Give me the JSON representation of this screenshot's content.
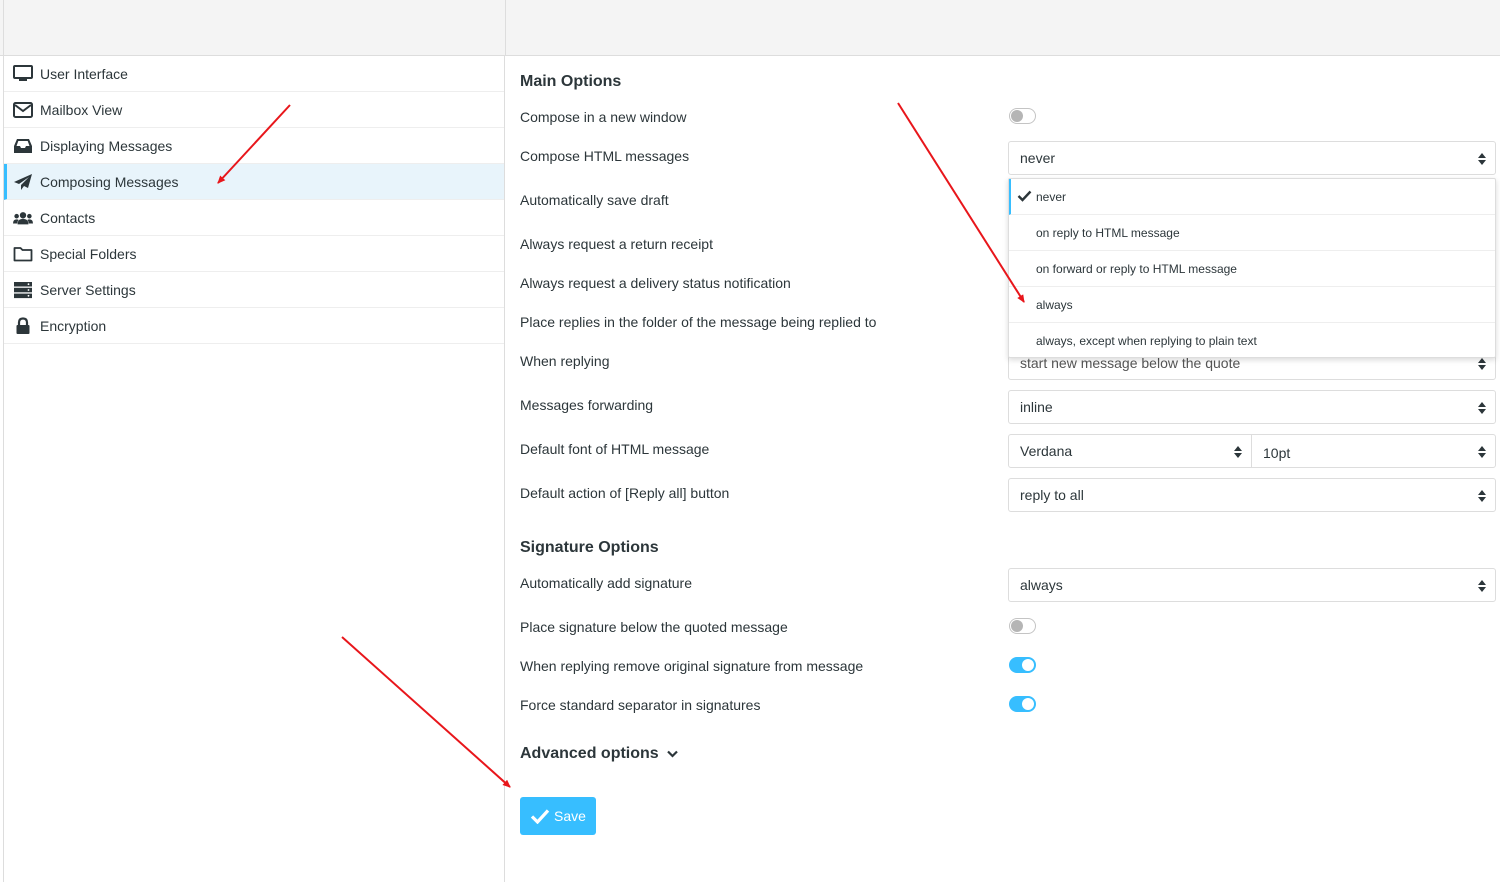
{
  "sidebar": {
    "items": [
      {
        "label": "User Interface",
        "icon": "monitor-icon"
      },
      {
        "label": "Mailbox View",
        "icon": "envelope-icon"
      },
      {
        "label": "Displaying Messages",
        "icon": "inbox-icon"
      },
      {
        "label": "Composing Messages",
        "icon": "paper-plane-icon",
        "selected": true
      },
      {
        "label": "Contacts",
        "icon": "users-icon"
      },
      {
        "label": "Special Folders",
        "icon": "folder-icon"
      },
      {
        "label": "Server Settings",
        "icon": "server-icon"
      },
      {
        "label": "Encryption",
        "icon": "lock-icon"
      }
    ]
  },
  "main": {
    "title": "Main Options",
    "compose_new_window": {
      "label": "Compose in a new window",
      "checked": false
    },
    "compose_html": {
      "label": "Compose HTML messages",
      "value": "never"
    },
    "auto_save_draft": {
      "label": "Automatically save draft"
    },
    "return_receipt": {
      "label": "Always request a return receipt"
    },
    "delivery_status": {
      "label": "Always request a delivery status notification"
    },
    "place_replies": {
      "label": "Place replies in the folder of the message being replied to"
    },
    "when_replying": {
      "label": "When replying",
      "value": "start new message below the quote"
    },
    "forwarding": {
      "label": "Messages forwarding",
      "value": "inline"
    },
    "default_font": {
      "label": "Default font of HTML message",
      "font": "Verdana",
      "size": "10pt"
    },
    "reply_all": {
      "label": "Default action of [Reply all] button",
      "value": "reply to all"
    }
  },
  "dropdown": {
    "options": [
      "never",
      "on reply to HTML message",
      "on forward or reply to HTML message",
      "always",
      "always, except when replying to plain text"
    ],
    "selected": "never"
  },
  "signature": {
    "title": "Signature Options",
    "auto_add": {
      "label": "Automatically add signature",
      "value": "always"
    },
    "below_quoted": {
      "label": "Place signature below the quoted message",
      "checked": false
    },
    "remove_original": {
      "label": "When replying remove original signature from message",
      "checked": true
    },
    "force_separator": {
      "label": "Force standard separator in signatures",
      "checked": true
    }
  },
  "advanced": {
    "label": "Advanced options"
  },
  "save_button": {
    "label": "Save"
  },
  "colors": {
    "accent": "#37beff",
    "annotation_arrow": "#e8161b"
  }
}
